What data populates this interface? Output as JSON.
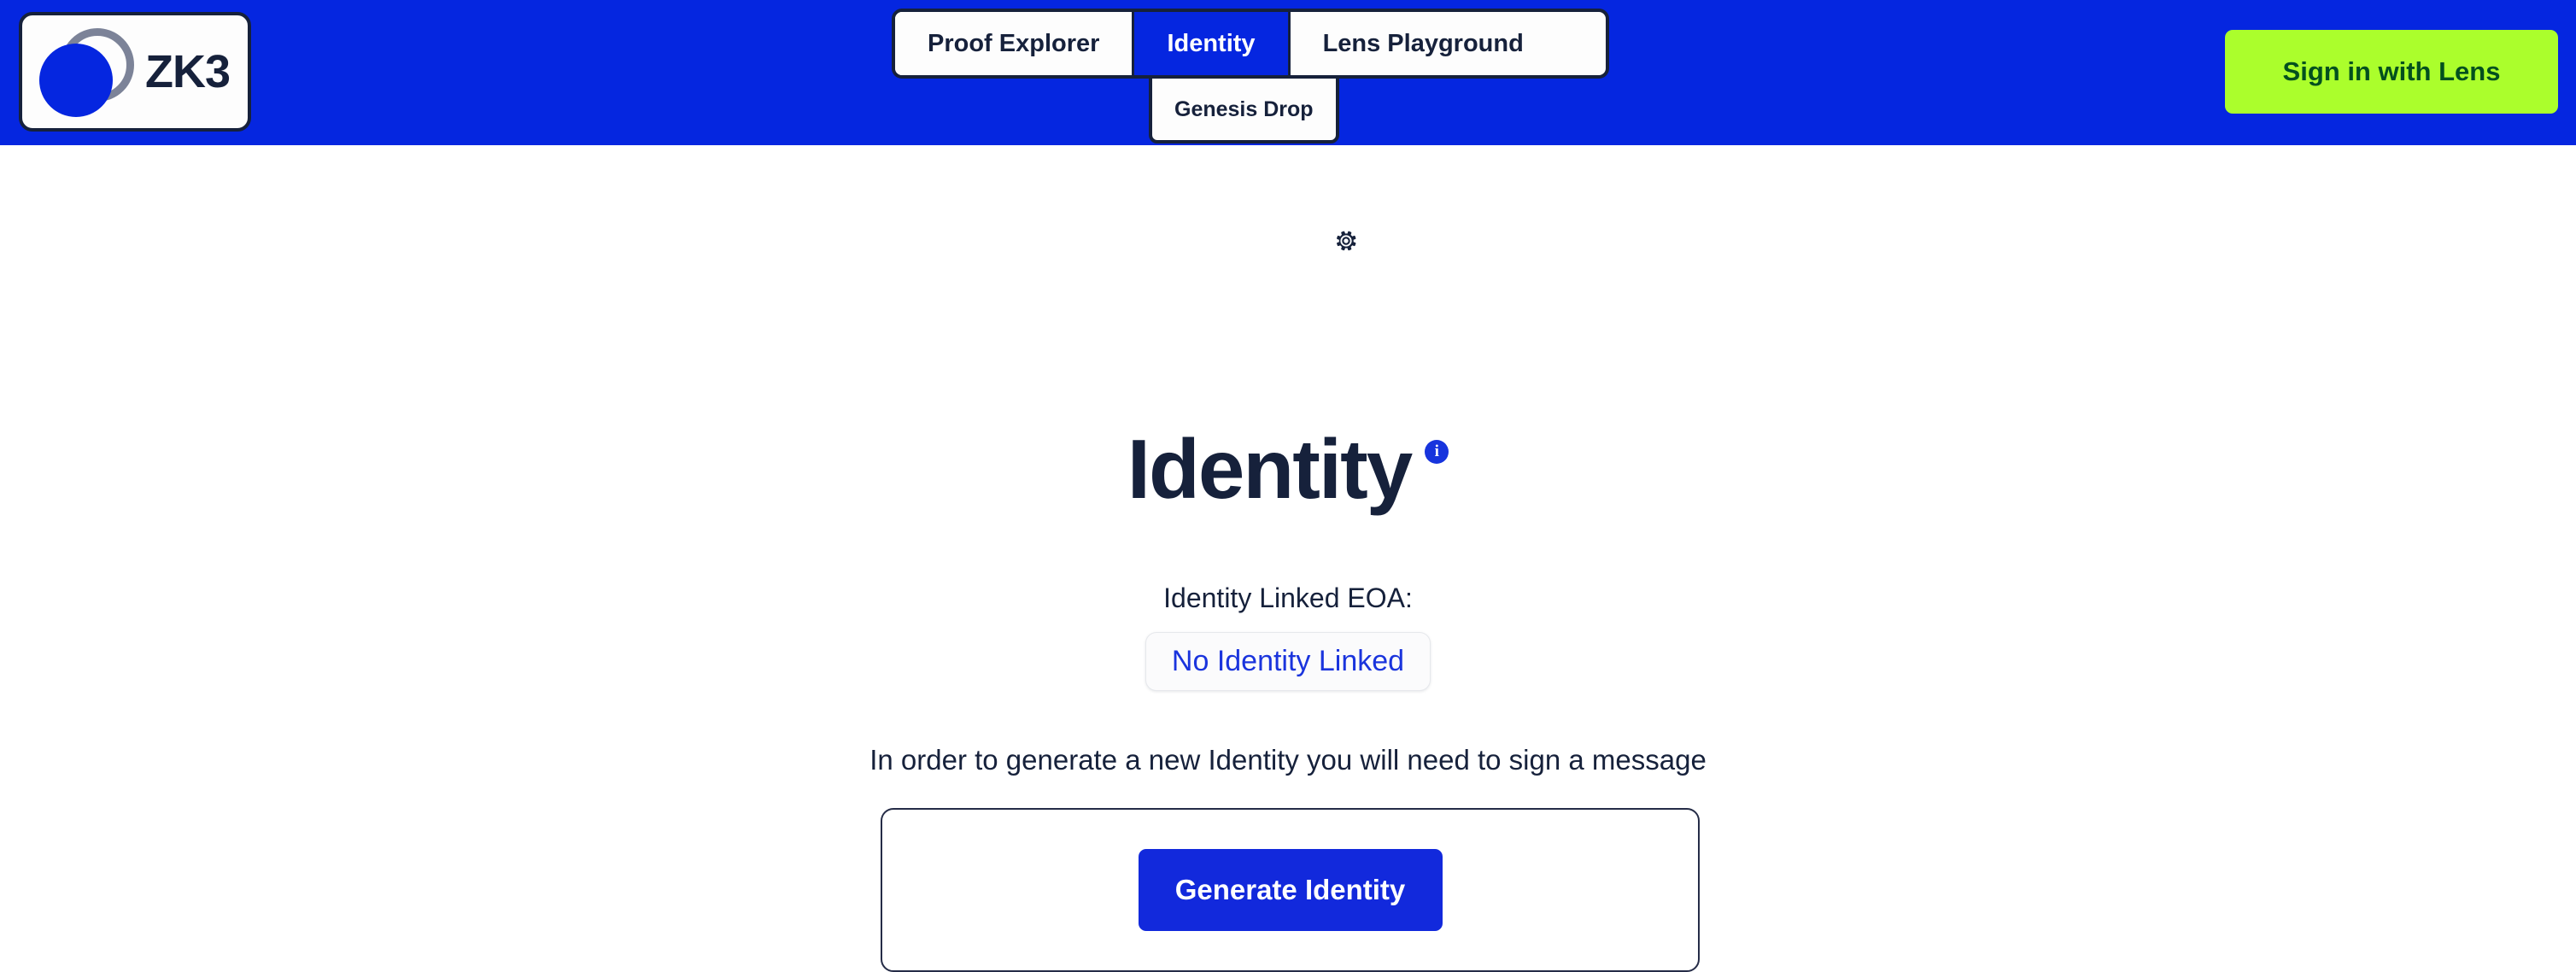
{
  "header": {
    "background_color": "#0526E0",
    "logo": {
      "text": "ZK3",
      "ring_color": "#7C8398",
      "disc_color": "#0526E0"
    },
    "nav": {
      "tabs": [
        {
          "label": "Proof Explorer",
          "active": false
        },
        {
          "label": "Identity",
          "active": true
        },
        {
          "label": "Lens Playground",
          "active": false
        }
      ],
      "submenu": [
        {
          "label": "Genesis Drop"
        }
      ]
    },
    "auth": {
      "sign_in_label": "Sign in with Lens",
      "accent_color": "#ABFE2C",
      "text_color": "#00501E"
    }
  },
  "main": {
    "settings_icon": "gear-icon",
    "title": "Identity",
    "info_icon": "info-icon",
    "info_icon_glyph": "i",
    "eoa_label": "Identity Linked EOA:",
    "eoa_value": "No Identity Linked",
    "eoa_value_color": "#1A34DD",
    "hint": "In order to generate a new Identity you will need to sign a message",
    "generate_button_label": "Generate Identity",
    "generate_button_color": "#1229DC"
  }
}
